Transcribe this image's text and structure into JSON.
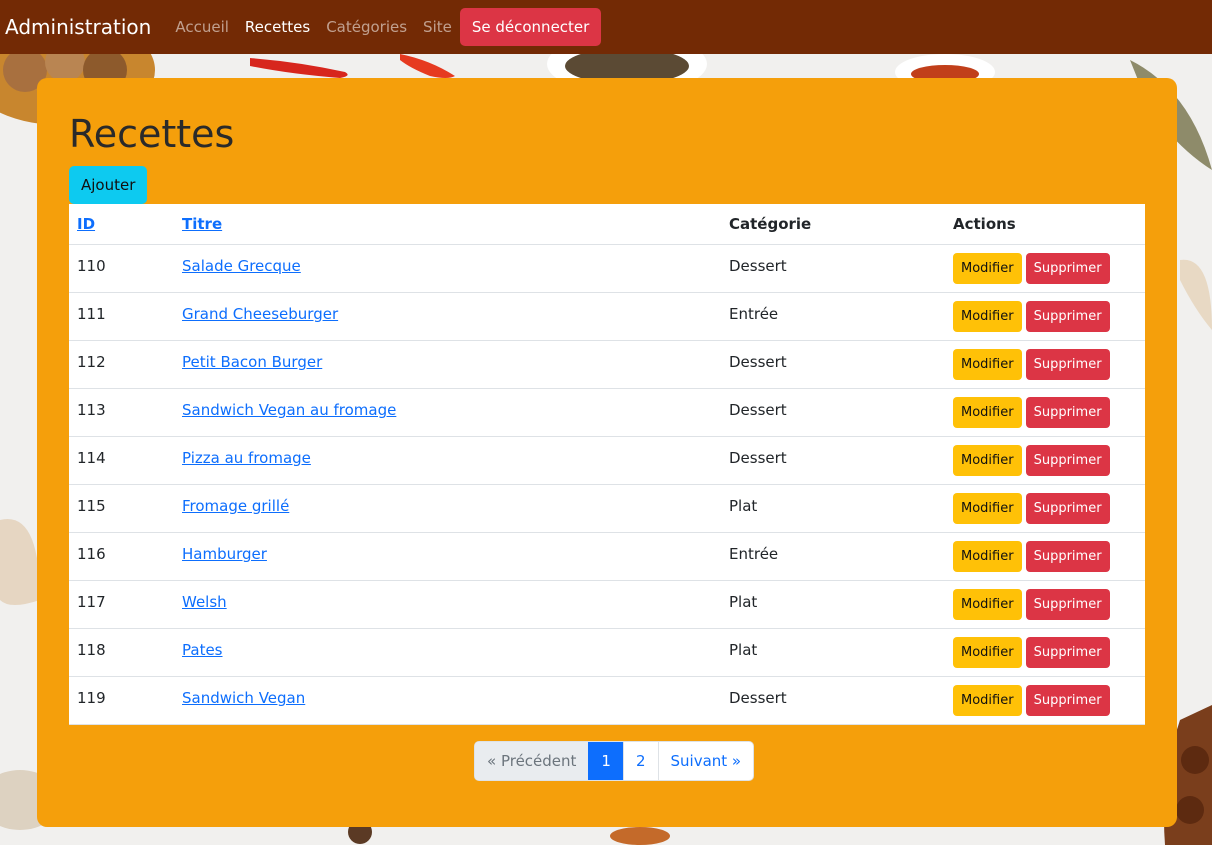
{
  "navbar": {
    "brand": "Administration",
    "links": [
      {
        "label": "Accueil",
        "active": false
      },
      {
        "label": "Recettes",
        "active": true
      },
      {
        "label": "Catégories",
        "active": false
      },
      {
        "label": "Site",
        "active": false
      }
    ],
    "logout_label": "Se déconnecter"
  },
  "main": {
    "title": "Recettes",
    "add_label": "Ajouter",
    "table": {
      "headers": {
        "id": "ID",
        "title": "Titre",
        "category": "Catégorie",
        "actions": "Actions"
      },
      "edit_label": "Modifier",
      "delete_label": "Supprimer",
      "rows": [
        {
          "id": "110",
          "title": "Salade Grecque",
          "category": "Dessert"
        },
        {
          "id": "111",
          "title": "Grand Cheeseburger",
          "category": "Entrée"
        },
        {
          "id": "112",
          "title": "Petit Bacon Burger",
          "category": "Dessert"
        },
        {
          "id": "113",
          "title": "Sandwich Vegan au fromage",
          "category": "Dessert"
        },
        {
          "id": "114",
          "title": "Pizza au fromage",
          "category": "Dessert"
        },
        {
          "id": "115",
          "title": "Fromage grillé",
          "category": "Plat"
        },
        {
          "id": "116",
          "title": "Hamburger",
          "category": "Entrée"
        },
        {
          "id": "117",
          "title": "Welsh",
          "category": "Plat"
        },
        {
          "id": "118",
          "title": "Pates",
          "category": "Plat"
        },
        {
          "id": "119",
          "title": "Sandwich Vegan",
          "category": "Dessert"
        }
      ]
    },
    "pagination": {
      "prev_label": "« Précédent",
      "pages": [
        "1",
        "2"
      ],
      "current_page": "1",
      "next_label": "Suivant »"
    }
  },
  "colors": {
    "navbar": "#732a05",
    "panel": "#f59f0b",
    "add_button": "#0dcaf0",
    "edit_button": "#ffc107",
    "delete_button": "#dc3545",
    "link": "#0d6efd"
  },
  "background": {
    "description_icons": [
      "spice-bowl-icon",
      "chili-pepper-icon",
      "garlic-icon",
      "star-anise-icon",
      "bay-leaf-icon"
    ]
  }
}
